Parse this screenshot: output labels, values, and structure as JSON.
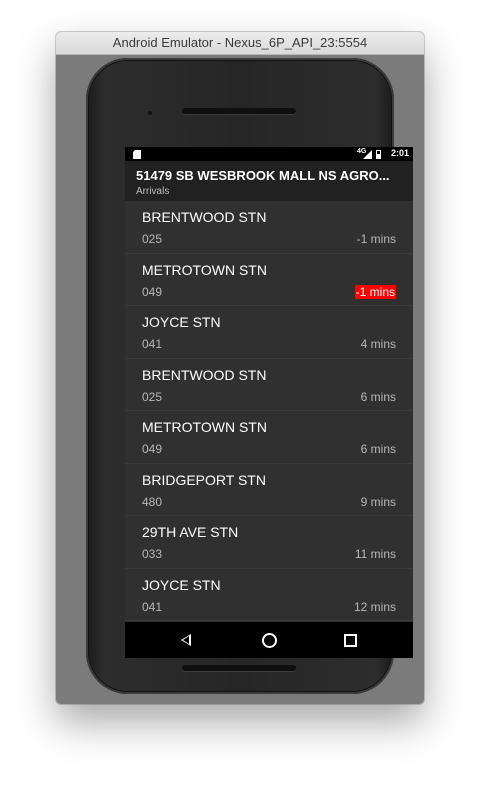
{
  "window": {
    "title": "Android Emulator - Nexus_6P_API_23:5554"
  },
  "statusbar": {
    "network": "4G",
    "time": "2:01"
  },
  "appbar": {
    "title": "51479 SB WESBROOK MALL NS AGRO...",
    "subtitle": "Arrivals"
  },
  "arrivals": [
    {
      "destination": "BRENTWOOD STN",
      "route": "025",
      "eta": "-1 mins",
      "highlighted": false
    },
    {
      "destination": "METROTOWN STN",
      "route": "049",
      "eta": "-1 mins",
      "highlighted": true
    },
    {
      "destination": "JOYCE STN",
      "route": "041",
      "eta": "4 mins",
      "highlighted": false
    },
    {
      "destination": "BRENTWOOD STN",
      "route": "025",
      "eta": "6 mins",
      "highlighted": false
    },
    {
      "destination": "METROTOWN STN",
      "route": "049",
      "eta": "6 mins",
      "highlighted": false
    },
    {
      "destination": "BRIDGEPORT STN",
      "route": "480",
      "eta": "9 mins",
      "highlighted": false
    },
    {
      "destination": "29TH AVE STN",
      "route": "033",
      "eta": "11 mins",
      "highlighted": false
    },
    {
      "destination": "JOYCE STN",
      "route": "041",
      "eta": "12 mins",
      "highlighted": false
    }
  ],
  "colors": {
    "highlight": "#ff0000",
    "background": "#303030",
    "appbar": "#212121"
  },
  "icons": {
    "status": [
      "sd-card-icon",
      "signal-icon",
      "battery-icon"
    ],
    "navigation": [
      "back-icon",
      "home-icon",
      "recents-icon"
    ]
  }
}
